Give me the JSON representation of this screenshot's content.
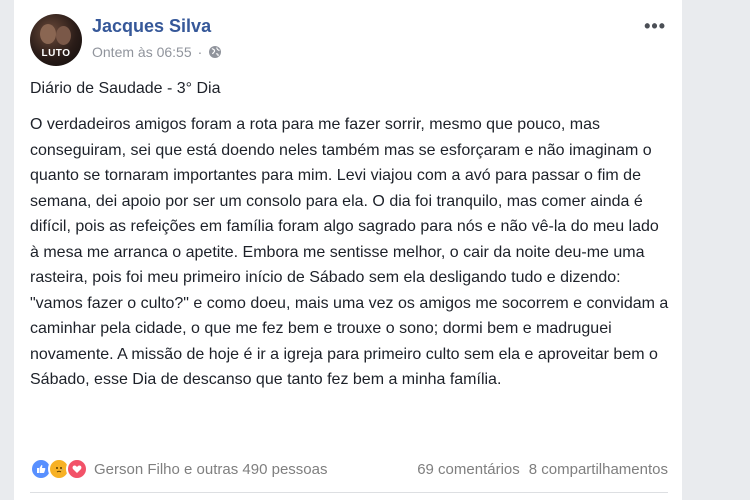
{
  "post": {
    "author": "Jacques Silva",
    "timestamp": "Ontem às 06:55",
    "privacy_icon": "globe-icon",
    "avatar_badge": "LUTO",
    "more_label": "•••",
    "title": "Diário de Saudade - 3° Dia",
    "body": "O verdadeiros amigos foram a rota para me fazer sorrir, mesmo que pouco, mas conseguiram, sei que está doendo neles também mas se esforçaram e não imaginam o quanto se tornaram importantes para mim. Levi viajou com a avó para passar o fim de semana, dei apoio por ser um consolo para ela. O dia foi tranquilo, mas comer ainda é difícil, pois as refeições em família foram algo sagrado para nós e não vê-la do meu lado à mesa me arranca o apetite. Embora me sentisse melhor, o cair da noite deu-me uma rasteira, pois foi meu primeiro início de Sábado sem ela desligando tudo e dizendo: \"vamos fazer o culto?\" e como doeu, mais uma vez os amigos me socorrem e convidam a caminhar pela cidade, o que me fez bem e trouxe o sono; dormi bem e madruguei novamente. A missão de hoje é ir a igreja para primeiro culto sem ela e aproveitar bem o Sábado, esse Dia de descanso que tanto fez bem a minha família."
  },
  "footer": {
    "reactions": [
      "like-icon",
      "sad-icon",
      "love-icon"
    ],
    "reaction_names": "Gerson Filho e outras 490 pessoas",
    "comments": "69 comentários",
    "shares": "8 compartilhamentos"
  },
  "colors": {
    "author_link": "#365899",
    "text": "#1d2129",
    "meta": "#90949c",
    "like": "#5890ff",
    "sad": "#f7b125",
    "love": "#f25268"
  }
}
